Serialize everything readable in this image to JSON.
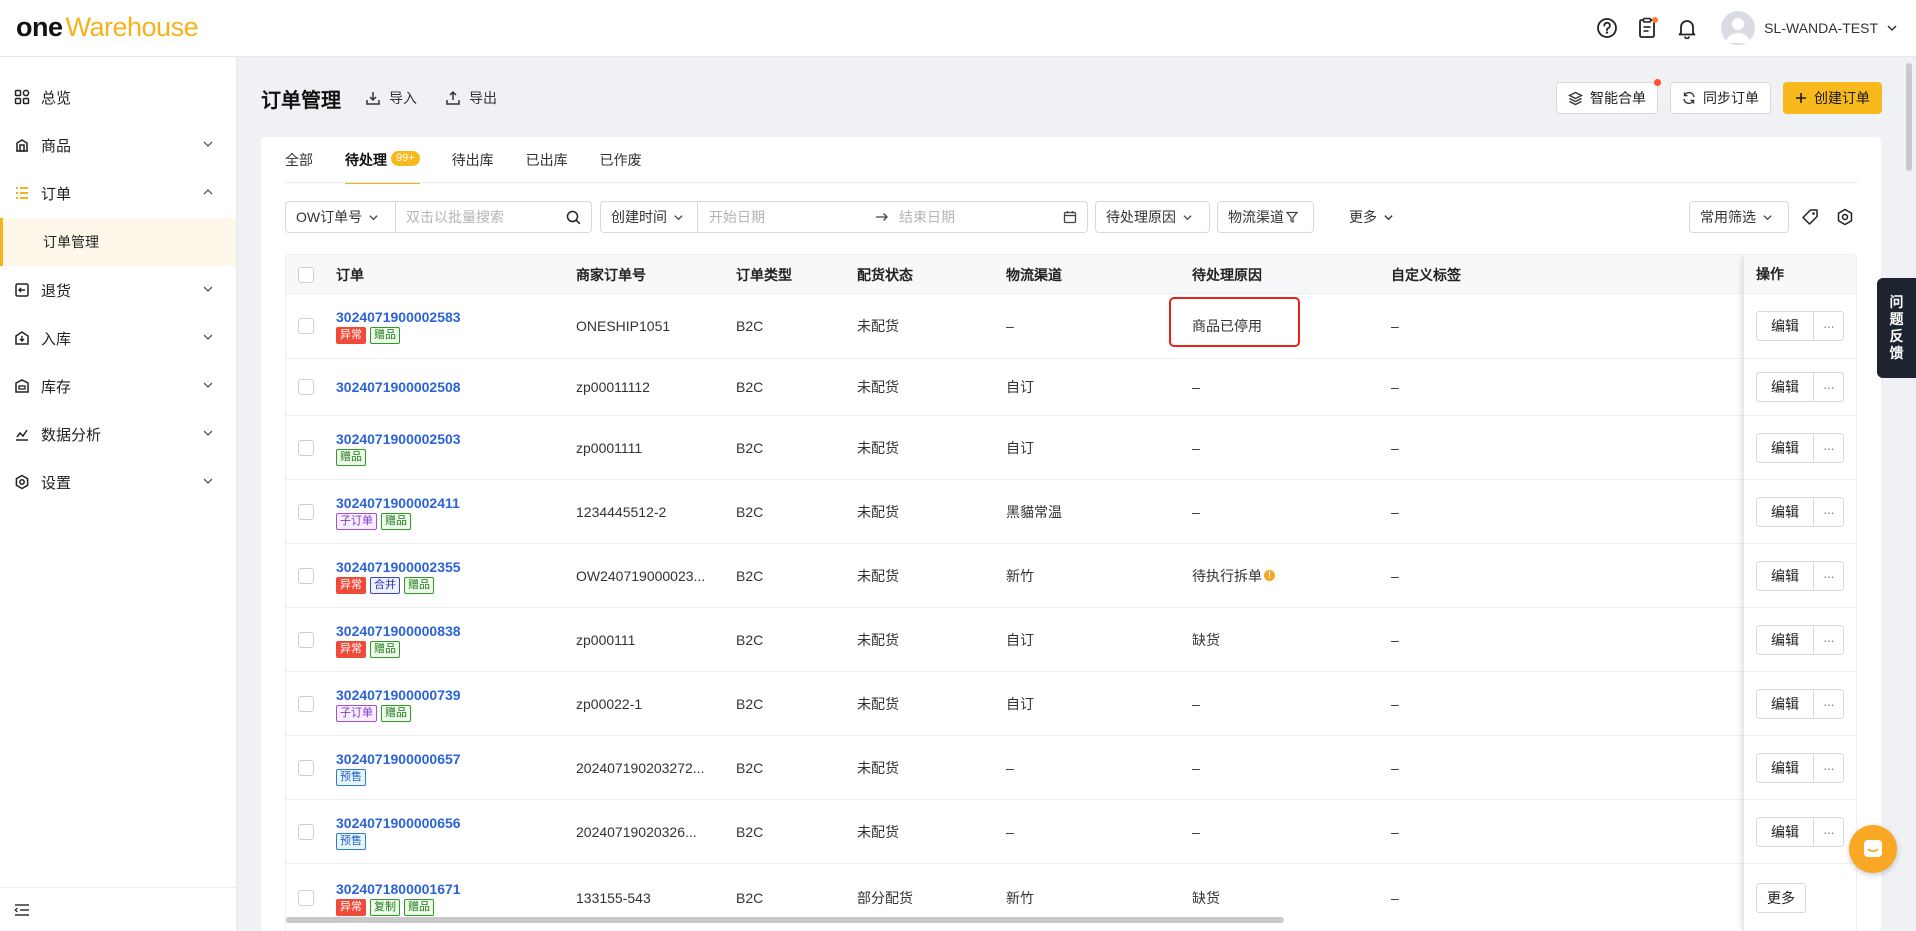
{
  "app": {
    "logo_one": "one",
    "logo_warehouse": "Warehouse",
    "user_name": "SL-WANDA-TEST"
  },
  "topbar_icons": [
    "help-icon",
    "clipboard-icon",
    "bell-icon"
  ],
  "sidebar": {
    "items": [
      {
        "label": "总览",
        "icon": "dashboard-icon"
      },
      {
        "label": "商品",
        "icon": "goods-icon"
      },
      {
        "label": "订单",
        "icon": "order-icon"
      },
      {
        "label": "订单管理"
      },
      {
        "label": "退货",
        "icon": "return-icon"
      },
      {
        "label": "入库",
        "icon": "inbound-icon"
      },
      {
        "label": "库存",
        "icon": "inventory-icon"
      },
      {
        "label": "数据分析",
        "icon": "analytics-icon"
      },
      {
        "label": "设置",
        "icon": "settings-icon"
      }
    ]
  },
  "header": {
    "title": "订单管理",
    "import_label": "导入",
    "export_label": "导出",
    "smart_merge_label": "智能合单",
    "sync_label": "同步订单",
    "create_label": "创建订单"
  },
  "tabs": [
    {
      "label": "全部"
    },
    {
      "label": "待处理",
      "badge": "99+"
    },
    {
      "label": "待出库"
    },
    {
      "label": "已出库"
    },
    {
      "label": "已作废"
    }
  ],
  "filters": {
    "order_type_select": "OW订单号",
    "search_placeholder": "双击以批量搜索",
    "time_select": "创建时间",
    "start_placeholder": "开始日期",
    "end_placeholder": "结束日期",
    "reason_select": "待处理原因",
    "channel_select": "物流渠道",
    "more_label": "更多",
    "common_filter_label": "常用筛选"
  },
  "table": {
    "columns": [
      "订单",
      "商家订单号",
      "订单类型",
      "配货状态",
      "物流渠道",
      "待处理原因",
      "自定义标签",
      "操作"
    ],
    "rows": [
      {
        "order": "3024071900002583",
        "tags": [
          {
            "text": "异常",
            "kind": "abn"
          },
          {
            "text": "赠品",
            "kind": "gift"
          }
        ],
        "merchant": "ONESHIP1051",
        "type": "B2C",
        "status": "未配货",
        "channel": "–",
        "reason": "商品已停用",
        "custom": "–",
        "action": "编辑"
      },
      {
        "order": "3024071900002508",
        "tags": [],
        "merchant": "zp00011112",
        "type": "B2C",
        "status": "未配货",
        "channel": "自订",
        "reason": "–",
        "custom": "–",
        "action": "编辑"
      },
      {
        "order": "3024071900002503",
        "tags": [
          {
            "text": "赠品",
            "kind": "gift"
          }
        ],
        "merchant": "zp0001111",
        "type": "B2C",
        "status": "未配货",
        "channel": "自订",
        "reason": "–",
        "custom": "–",
        "action": "编辑"
      },
      {
        "order": "3024071900002411",
        "tags": [
          {
            "text": "子订单",
            "kind": "sub"
          },
          {
            "text": "赠品",
            "kind": "gift"
          }
        ],
        "merchant": "1234445512-2",
        "type": "B2C",
        "status": "未配货",
        "channel": "黑貓常温",
        "reason": "–",
        "custom": "–",
        "action": "编辑"
      },
      {
        "order": "3024071900002355",
        "tags": [
          {
            "text": "异常",
            "kind": "abn"
          },
          {
            "text": "合并",
            "kind": "merge"
          },
          {
            "text": "赠品",
            "kind": "gift"
          }
        ],
        "merchant": "OW240719000023...",
        "type": "B2C",
        "status": "未配货",
        "channel": "新竹",
        "reason": "待执行拆单",
        "custom": "–",
        "action": "编辑"
      },
      {
        "order": "3024071900000838",
        "tags": [
          {
            "text": "异常",
            "kind": "abn"
          },
          {
            "text": "赠品",
            "kind": "gift"
          }
        ],
        "merchant": "zp000111",
        "type": "B2C",
        "status": "未配货",
        "channel": "自订",
        "reason": "缺货",
        "custom": "–",
        "action": "编辑"
      },
      {
        "order": "3024071900000739",
        "tags": [
          {
            "text": "子订单",
            "kind": "sub"
          },
          {
            "text": "赠品",
            "kind": "gift"
          }
        ],
        "merchant": "zp00022-1",
        "type": "B2C",
        "status": "未配货",
        "channel": "自订",
        "reason": "–",
        "custom": "–",
        "action": "编辑"
      },
      {
        "order": "3024071900000657",
        "tags": [
          {
            "text": "预售",
            "kind": "pre"
          }
        ],
        "merchant": "202407190203272...",
        "type": "B2C",
        "status": "未配货",
        "channel": "–",
        "reason": "–",
        "custom": "–",
        "action": "编辑"
      },
      {
        "order": "3024071900000656",
        "tags": [
          {
            "text": "预售",
            "kind": "pre"
          }
        ],
        "merchant": "20240719020326...",
        "type": "B2C",
        "status": "未配货",
        "channel": "–",
        "reason": "–",
        "custom": "–",
        "action": "编辑"
      },
      {
        "order": "3024071800001671",
        "tags": [
          {
            "text": "异常",
            "kind": "abn"
          },
          {
            "text": "复制",
            "kind": "copy"
          },
          {
            "text": "赠品",
            "kind": "gift"
          }
        ],
        "merchant": "133155-543",
        "type": "B2C",
        "status": "部分配货",
        "channel": "新竹",
        "reason": "缺货",
        "custom": "–",
        "action": "更多"
      }
    ]
  },
  "feedback_label": [
    "问",
    "题",
    "反",
    "馈"
  ],
  "colors": {
    "brand": "#f5b21b",
    "link": "#2b63d9",
    "highlight": "#e8211c"
  }
}
